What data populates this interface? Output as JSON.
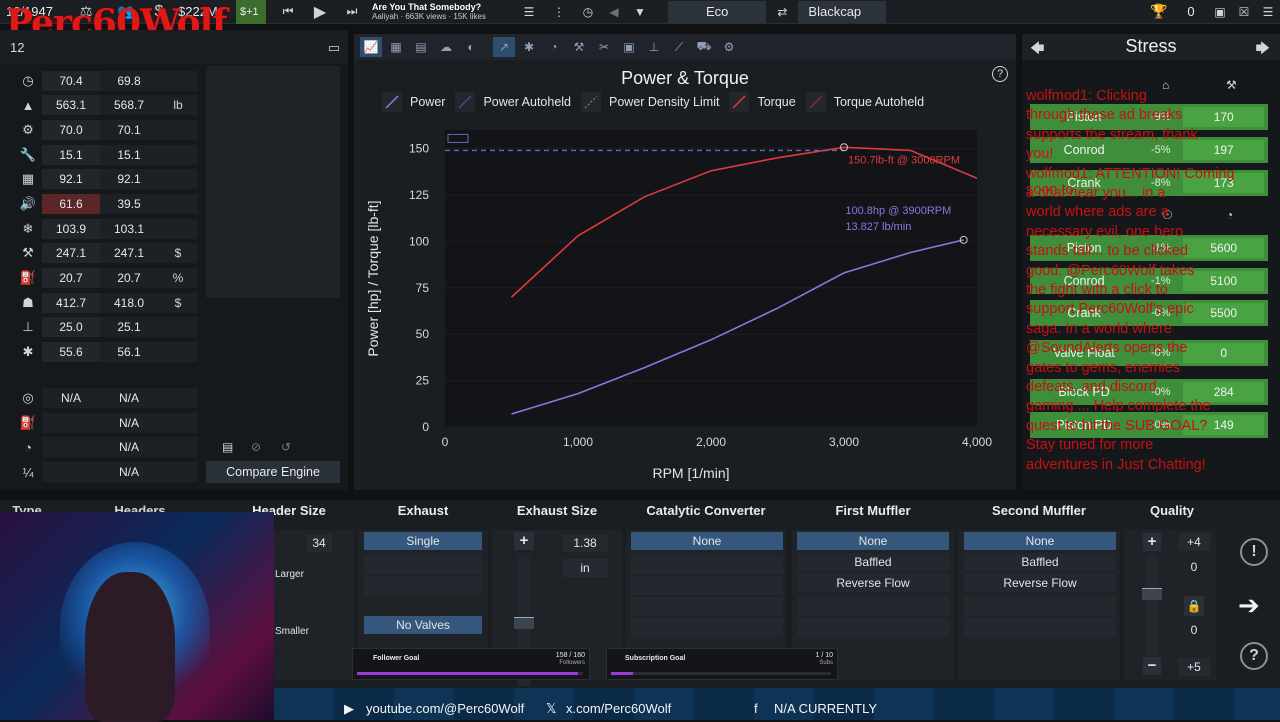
{
  "topbar": {
    "date": "12/1947",
    "money": "$222M",
    "delta": "$+1",
    "song_title": "Are You That Somebody?",
    "song_meta": "Aaliyah · 663K views · 15K likes",
    "eco_label": "Eco",
    "blackcap_label": "Blackcap",
    "trophy_count": "0"
  },
  "overlay": {
    "streamer_name": "Perc60Wolf"
  },
  "left_panel": {
    "header": "12",
    "rows": [
      {
        "icon": "speedometer-icon",
        "v1": "70.4",
        "v2": "69.8",
        "unit": ""
      },
      {
        "icon": "weight-icon",
        "v1": "563.1",
        "v2": "568.7",
        "unit": "lb"
      },
      {
        "icon": "engine-icon",
        "v1": "70.0",
        "v2": "70.1",
        "unit": ""
      },
      {
        "icon": "wrench-icon",
        "v1": "15.1",
        "v2": "15.1",
        "unit": ""
      },
      {
        "icon": "grid-icon",
        "v1": "92.1",
        "v2": "92.1",
        "unit": ""
      },
      {
        "icon": "speaker-icon",
        "v1": "61.6",
        "v2": "39.5",
        "unit": ""
      },
      {
        "icon": "snowflake-icon",
        "v1": "103.9",
        "v2": "103.1",
        "unit": ""
      },
      {
        "icon": "tools-icon",
        "v1": "247.1",
        "v2": "247.1",
        "unit": "$"
      },
      {
        "icon": "fuel-icon",
        "v1": "20.7",
        "v2": "20.7",
        "unit": "%"
      },
      {
        "icon": "worker-icon",
        "v1": "412.7",
        "v2": "418.0",
        "unit": "$"
      },
      {
        "icon": "anvil-icon",
        "v1": "25.0",
        "v2": "25.1",
        "unit": ""
      },
      {
        "icon": "gear-icon",
        "v1": "55.6",
        "v2": "56.1",
        "unit": ""
      }
    ],
    "rows2": [
      {
        "icon": "turbo-icon",
        "v1": "N/A",
        "v2": "N/A"
      },
      {
        "icon": "fuel-icon",
        "v1": "",
        "v2": "N/A"
      },
      {
        "icon": "gauge-icon",
        "v1": "",
        "v2": "N/A"
      },
      {
        "icon": "quarter-mile-icon",
        "v1": "",
        "v2": "N/A"
      }
    ],
    "compare_label": "Compare Engine"
  },
  "graph": {
    "title": "Power & Torque",
    "legend": [
      "Power",
      "Power Autoheld",
      "Power Density Limit",
      "Torque",
      "Torque Autoheld"
    ],
    "annot_torque": "150.7lb-ft @ 3000RPM",
    "annot_power1": "100.8hp @ 3900RPM",
    "annot_power2": "13.827 lb/min",
    "colors": {
      "power": "#7f70d6",
      "torque": "#d8333a",
      "limit": "#7a6fc4"
    }
  },
  "chart_data": {
    "type": "line",
    "title": "Power & Torque",
    "xlabel": "RPM [1/min]",
    "ylabel": "Power [hp] / Torque [lb-ft]",
    "xlim": [
      0,
      4000
    ],
    "ylim": [
      0,
      160
    ],
    "xticks": [
      "0",
      "1,000",
      "2,000",
      "3,000",
      "4,000"
    ],
    "yticks": [
      "0",
      "25",
      "50",
      "75",
      "100",
      "125",
      "150"
    ],
    "series": [
      {
        "name": "Power",
        "x": [
          500,
          1000,
          1500,
          2000,
          2500,
          3000,
          3500,
          3900
        ],
        "y": [
          7,
          18,
          32,
          47,
          64,
          83,
          94,
          100.8
        ]
      },
      {
        "name": "Torque",
        "x": [
          500,
          1000,
          1500,
          2000,
          2500,
          3000,
          3500,
          4000
        ],
        "y": [
          70,
          103,
          124,
          138,
          145,
          150.7,
          149,
          134
        ]
      },
      {
        "name": "Power Density Limit",
        "x": [
          0,
          3000
        ],
        "y": [
          149,
          149
        ]
      }
    ]
  },
  "stress": {
    "title": "Stress",
    "rows": [
      {
        "name": "Piston",
        "pct": "-9%",
        "val": "170"
      },
      {
        "name": "Conrod",
        "pct": "-5%",
        "val": "197"
      },
      {
        "name": "Crank",
        "pct": "-8%",
        "val": "173"
      },
      {
        "name": "Piston",
        "pct": "-1%",
        "val": "5600"
      },
      {
        "name": "Conrod",
        "pct": "-1%",
        "val": "5100"
      },
      {
        "name": "Crank",
        "pct": "-0%",
        "val": "5500"
      },
      {
        "name": "Valve Float",
        "pct": "-0%",
        "val": "0"
      },
      {
        "name": "Block PD",
        "pct": "-0%",
        "val": "284"
      },
      {
        "name": "Piston PD",
        "pct": "-0%",
        "val": "149"
      }
    ],
    "chat": [
      "wolfmod1: Clicking",
      "through these ad breaks",
      "supports the stream, thank",
      "you!",
      "wolfmod1: ATTENTION! Coming soon to",
      "a chat near you... in a",
      "world where ads are a",
      "necessary evil, one hero",
      "stands tall... to be clicked",
      "good. @Perc60Wolf takes",
      "the fight with a click to",
      "support Perc60Wolf's epic",
      "saga. In a world where",
      "@SoundAlerts opens the",
      "gates to gems, enemies",
      "defeats, and discord",
      "gaming ... Help complete the",
      "quest to hit the SUB GOAL?",
      "Stay tuned for more",
      "adventures in Just Chatting!"
    ]
  },
  "bottom": {
    "headers": [
      "Type",
      "Headers",
      "Header Size",
      "Exhaust",
      "Exhaust Size",
      "Catalytic Converter",
      "First Muffler",
      "Second Muffler",
      "Quality"
    ],
    "header_size": "34",
    "larger_label": "Larger",
    "smaller_label": "Smaller",
    "exhaust_opts": [
      "Single",
      "No Valves"
    ],
    "exhaust_size": "1.38",
    "exhaust_unit": "in",
    "cat_opts": [
      "None"
    ],
    "muffler1": [
      "None",
      "Baffled",
      "Reverse Flow"
    ],
    "muffler2": [
      "None",
      "Baffled",
      "Reverse Flow"
    ],
    "quality_top": "+4",
    "quality_v1": "0",
    "quality_v2": "0",
    "quality_bottom": "+5",
    "follower_goal": "Follower Goal",
    "follower_count": "158 / 160",
    "follower_unit": "Followers",
    "sub_goal": "Subscription Goal",
    "sub_count": "1 / 10",
    "sub_unit": "Subs"
  },
  "socials": {
    "youtube": "youtube.com/@Perc60Wolf",
    "x": "x.com/Perc60Wolf",
    "fb": "N/A CURRENTLY"
  }
}
